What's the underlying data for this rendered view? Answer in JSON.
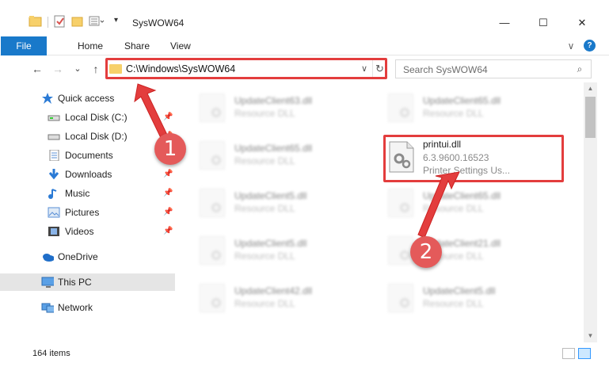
{
  "window": {
    "title": "SysWOW64",
    "minimize": "—",
    "maximize": "☐",
    "close": "✕"
  },
  "ribbon": {
    "tabs": [
      "File",
      "Home",
      "Share",
      "View"
    ],
    "expand": "∨",
    "help": "?"
  },
  "address": {
    "back": "←",
    "forward": "→",
    "recent": "⌄",
    "up": "↑",
    "path": "C:\\Windows\\SysWOW64",
    "dropdown": "∨",
    "refresh": "↻",
    "search_placeholder": "Search SysWOW64",
    "search_icon": "⌕"
  },
  "nav": {
    "items": [
      {
        "label": "Quick access",
        "icon": "star-icon"
      },
      {
        "label": "Local Disk (C:)",
        "icon": "drive-icon",
        "pinned": true
      },
      {
        "label": "Local Disk (D:)",
        "icon": "drive-icon",
        "pinned": true
      },
      {
        "label": "Documents",
        "icon": "documents-icon",
        "pinned": true
      },
      {
        "label": "Downloads",
        "icon": "downloads-icon",
        "pinned": true
      },
      {
        "label": "Music",
        "icon": "music-icon",
        "pinned": true
      },
      {
        "label": "Pictures",
        "icon": "pictures-icon",
        "pinned": true
      },
      {
        "label": "Videos",
        "icon": "videos-icon",
        "pinned": true
      },
      {
        "label": "OneDrive",
        "icon": "onedrive-icon"
      },
      {
        "label": "This PC",
        "icon": "pc-icon",
        "selected": true
      },
      {
        "label": "Network",
        "icon": "network-icon"
      }
    ]
  },
  "files": [
    {
      "name": "UpdateClient63.dll",
      "desc": "Resource DLL"
    },
    {
      "name": "UpdateClient65.dll",
      "desc": "Resource DLL"
    },
    {
      "name": "UpdateClient65.dll",
      "desc": "Resource DLL"
    },
    {
      "name": "printui.dll",
      "desc": "6.3.9600.16523",
      "desc2": "Printer Settings Us..."
    },
    {
      "name": "UpdateClient5.dll",
      "desc": "Resource DLL"
    },
    {
      "name": "UpdateClient65.dll",
      "desc": "Resource DLL"
    },
    {
      "name": "UpdateClient5.dll",
      "desc": "Resource DLL"
    },
    {
      "name": "UpdateClient21.dll",
      "desc": "Resource DLL"
    },
    {
      "name": "UpdateClient42.dll",
      "desc": "Resource DLL"
    },
    {
      "name": "UpdateClient5.dll",
      "desc": "Resource DLL"
    }
  ],
  "status": {
    "count": "164 items"
  },
  "annotations": {
    "step1": "1",
    "step2": "2",
    "color": "#e33d3d"
  }
}
